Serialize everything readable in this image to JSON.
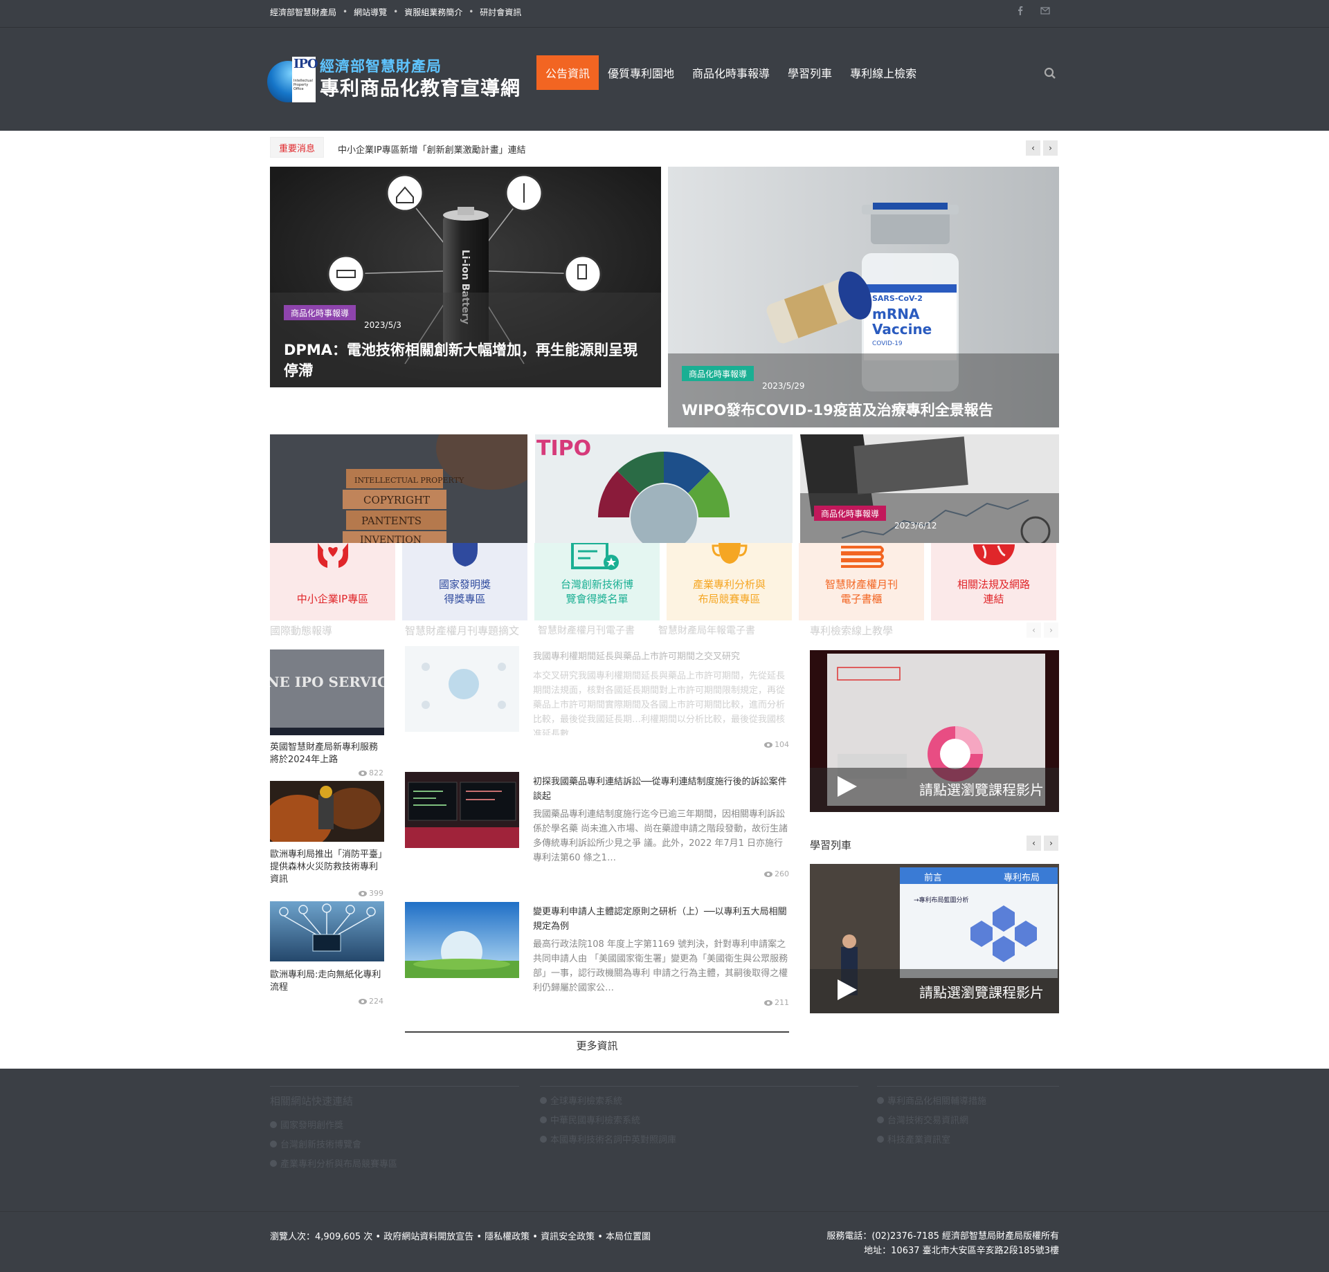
{
  "topbar": {
    "links": [
      "經濟部智慧財產局",
      "網站導覽",
      "資服組業務簡介",
      "研討會資訊"
    ],
    "separator": "•"
  },
  "header": {
    "logo_line1": "經濟部智慧財產局",
    "logo_line2": "專利商品化教育宣導網",
    "logo_mark": "IPO",
    "logo_small": "Intellectual Property Office",
    "nav": [
      "公告資訊",
      "優質專利園地",
      "商品化時事報導",
      "學習列車",
      "專利線上檢索"
    ]
  },
  "ticker": {
    "badge": "重要消息",
    "text": "中小企業IP專區新增「創新創業激勵計畫」連結"
  },
  "featured": [
    {
      "category": "商品化時事報導",
      "date": "2023/5/3",
      "title": "DPMA：電池技術相關創新大幅增加，再生能源則呈現停滯",
      "cat_color": "#8e44ad",
      "battery_label": "Li-ion Battery"
    },
    {
      "category": "商品化時事報導",
      "date": "2023/5/29",
      "title": "WIPO發布COVID-19疫苗及治療專利全景報告",
      "cat_color": "#1aaf93",
      "vial_label1": "SARS-CoV-2",
      "vial_label2": "mRNA",
      "vial_label3": "Vaccine",
      "vial_label4": "COVID-19"
    }
  ],
  "tiles": [
    {
      "blocks": [
        "INTELLECTUAL PROPERTY",
        "COPYRIGHT",
        "PANTENTS",
        "INVENTION"
      ]
    },
    {
      "brand": "TIPO"
    },
    {
      "category": "商品化時事報導",
      "date": "2023/6/12",
      "cat_color": "#c2185b"
    }
  ],
  "quick_links": [
    {
      "label": "中小企業IP專區",
      "color": "#e0262a",
      "bg": "#fbe9e9",
      "icon": "hands-heart-icon"
    },
    {
      "label": "國家發明獎\n得獎專區",
      "color": "#2f4a9e",
      "bg": "#eaedf6",
      "icon": "trophy-icon"
    },
    {
      "label": "台灣創新技術博\n覽會得獎名單",
      "color": "#1aaf93",
      "bg": "#e4f6f1",
      "icon": "certificate-icon"
    },
    {
      "label": "產業專利分析與\n布局競賽專區",
      "color": "#f5a623",
      "bg": "#fdf3e1",
      "icon": "cup-icon"
    },
    {
      "label": "智慧財產權月刊\n電子書櫃",
      "color": "#f26522",
      "bg": "#fdeee5",
      "icon": "books-icon"
    },
    {
      "label": "相關法規及網路\n連結",
      "color": "#e0262a",
      "bg": "#fbe9e9",
      "icon": "globe-icon"
    }
  ],
  "section_titles": {
    "intl": "國際動態報導",
    "monthly": "智慧財產權月刊專題摘文",
    "ebook": "智慧財產權月刊電子書",
    "annual": "智慧財產局年報電子書",
    "search_teach": "專利檢索線上教學",
    "train": "學習列車"
  },
  "left_news": [
    {
      "title": "英國智慧財產局新專利服務將於2024年上路",
      "views": "822",
      "thumb_text": "ONE IPO SERVICE"
    },
    {
      "title": "歐洲專利局推出「消防平臺」提供森林火災防救技術專利資訊",
      "views": "399"
    },
    {
      "title": "歐洲專利局:走向無紙化專利流程",
      "views": "224"
    }
  ],
  "articles": [
    {
      "title": "我國專利權期間延長與藥品上市許可期間之交叉研究",
      "excerpt": "本交叉研究我國專利權期間延長與藥品上市許可期間，先從延長期間法規面，核對各國延長期間對上市許可期間限制規定，再從藥品上市許可期間實際期間及各國上市許可期間比較，進而分析比較，最後從我國延長期…利權期間以分析比較，最後從我國核准延長數…",
      "views": "104"
    },
    {
      "title": "初探我國藥品專利連結訴訟──從專利連結制度施行後的訴訟案件談起",
      "excerpt": "我國藥品專利連結制度施行迄今已逾三年期間，因相關專利訴訟係於學名藥 尚未進入市場、尚在藥證申請之階段發動，故衍生諸多傳統專利訴訟所少見之爭 議。此外，2022 年7月1 日亦施行專利法第60 條之1…",
      "views": "260"
    },
    {
      "title": "變更專利申請人主體認定原則之研析（上）──以專利五大局相關規定為例",
      "excerpt": "最高行政法院108 年度上字第1169 號判決，針對專利申請案之共同申請人由 「美國國家衛生署」變更為「美國衛生與公眾服務部」一事，認行政機關為專利 申請之行為主體，其嗣後取得之權利仍歸屬於國家公…",
      "views": "211"
    }
  ],
  "videos": [
    {
      "caption": "請點選瀏覽課程影片"
    },
    {
      "caption": "請點選瀏覽課程影片",
      "screen_left": "前言",
      "screen_right": "專利布局",
      "screen_heading": "→專利布局藍圖分析"
    }
  ],
  "more_label": "更多資訊",
  "footer": {
    "col1_title": "相關網站快速連結",
    "col1": [
      "國家發明創作獎",
      "台灣創新技術博覽會",
      "產業專利分析與布局競賽專區"
    ],
    "col2": [
      "全球專利檢索系統",
      "中華民國專利檢索系統",
      "本國專利技術名詞中英對照詞庫"
    ],
    "col3": [
      "專利商品化相關輔導措施",
      "台灣技術交易資訊網",
      "科技產業資訊室"
    ],
    "bottom_left": "瀏覽人次：4,909,605 次 • 政府網站資料開放宣告 • 隱私權政策 • 資訊安全政策 • 本局位置圖",
    "bottom_right1": "服務電話：(02)2376-7185 經濟部智慧局財產局版權所有",
    "bottom_right2": "地址：10637 臺北市大安區辛亥路2段185號3樓"
  }
}
